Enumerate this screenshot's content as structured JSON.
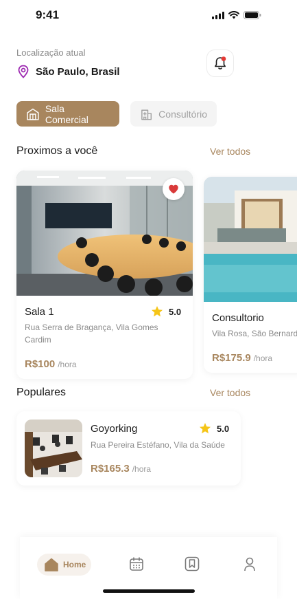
{
  "status": {
    "time": "9:41"
  },
  "location": {
    "label": "Localização atual",
    "value": "São Paulo, Brasil"
  },
  "categories": [
    {
      "label": "Sala Comercial",
      "active": true
    },
    {
      "label": "Consultório",
      "active": false
    }
  ],
  "nearby": {
    "title": "Proximos a você",
    "see_all": "Ver todos",
    "items": [
      {
        "name": "Sala 1",
        "rating": "5.0",
        "address": "Rua Serra de Bragança, Vila Gomes Cardim",
        "price": "R$100",
        "unit": "/hora",
        "favorite": true
      },
      {
        "name": "Consultorio",
        "address": "Vila Rosa, São Bernardo",
        "price": "R$175.9",
        "unit": "/hora"
      }
    ]
  },
  "popular": {
    "title": "Populares",
    "see_all": "Ver todos",
    "items": [
      {
        "name": "Goyorking",
        "rating": "5.0",
        "address": "Rua Pereira Estéfano, Vila da Saúde",
        "price": "R$165.3",
        "unit": "/hora"
      }
    ]
  },
  "nav": {
    "home_label": "Home"
  },
  "colors": {
    "accent": "#a8865e",
    "favorite": "#d93a3a",
    "star": "#f5c518",
    "notification_dot": "#e53935"
  }
}
